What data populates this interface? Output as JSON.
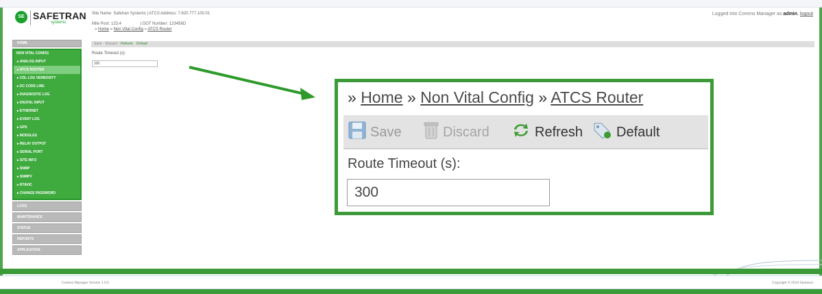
{
  "brand": {
    "badge": "SE",
    "name": "SAFETRAN",
    "sub": "systems"
  },
  "header": {
    "site_line": "Site Name: Safetran Systems  |  ATCS Address: 7.620.777.100.01",
    "mile_post": "Mile Post:  123.4",
    "dot_number": "|  DOT Number:  123456D",
    "crumb_prefix": "»",
    "crumb_home": "Home",
    "crumb_sep": "»",
    "crumb_config": "Non Vital Config",
    "crumb_router": "ATCS Router",
    "login_prefix": "Logged into Comms Manager as",
    "login_user": "admin",
    "logout": "logout"
  },
  "sidebar": {
    "home": "HOME",
    "group_title": "NON VITAL CONFIG",
    "items": [
      "▸ ANALOG INPUT",
      "▸ ATCS ROUTER",
      "▸ CDL LOG VERBOSITY",
      "▸ DC CODE LINE",
      "▸ DIAGNOSTIC LOG",
      "▸ DIGITAL INPUT",
      "▸ ETHERNET",
      "▸ EVENT LOG",
      "▸ GPS",
      "▸ MODULES",
      "▸ RELAY OUTPUT",
      "▸ SERIAL PORT",
      "▸ SITE INFO",
      "▸ SNMP",
      "▸ SNMPV",
      "▸ RTAVIC",
      "▸ CHANGE PASSWORD"
    ],
    "active_index": 1,
    "bottom": [
      "LOGS",
      "MAINTENANCE",
      "STATUS",
      "REPORTS",
      "APPLICATION"
    ]
  },
  "toolbar": {
    "save": "Save",
    "discard": "Discard",
    "refresh": "Refresh",
    "default": "Default"
  },
  "form": {
    "label": "Route Timeout (s):",
    "value": "300"
  },
  "zoom": {
    "crumb_prefix": "»",
    "crumb_home": "Home",
    "crumb_sep": "»",
    "crumb_config": "Non Vital Config",
    "crumb_router": "ATCS Router"
  },
  "footer": {
    "version": "Comms Manager Version 1.0.0",
    "copyright": "Copyright © 2014 Siemens"
  },
  "colors": {
    "brand_green": "#3fab3f",
    "callout_border": "#3c9a39"
  }
}
